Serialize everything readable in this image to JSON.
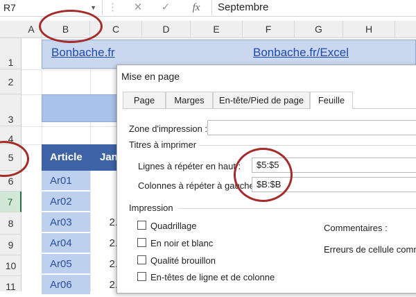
{
  "formula_bar": {
    "name_box": "R7",
    "cancel_icon": "✕",
    "enter_icon": "✓",
    "fx_label": "fx",
    "content": "Septembre"
  },
  "columns": [
    "A",
    "B",
    "C",
    "D",
    "E",
    "F",
    "G",
    "H"
  ],
  "rows": [
    "1",
    "2",
    "3",
    "4",
    "5",
    "6",
    "7",
    "8",
    "9",
    "10",
    "11"
  ],
  "sheet": {
    "banner_left": "Bonbache.fr",
    "banner_right": "Bonbache.fr/Excel",
    "table_header": "Article",
    "table_header_cut": "Janv",
    "articles": [
      "Ar01",
      "Ar02",
      "Ar03",
      "Ar04",
      "Ar05",
      "Ar06"
    ],
    "values_cut": [
      "",
      "",
      "2.",
      "2.",
      "2.",
      "2."
    ]
  },
  "dialog": {
    "title": "Mise en page",
    "tabs": [
      "Page",
      "Marges",
      "En-tête/Pied de page",
      "Feuille"
    ],
    "active_tab": "Feuille",
    "print_area_label": "Zone d'impression :",
    "print_area_value": "",
    "titles_group": "Titres à imprimer",
    "rows_repeat_label": "Lignes à répéter en haut :",
    "rows_repeat_value": "$5:$5",
    "cols_repeat_label": "Colonnes à répéter à gauche :",
    "cols_repeat_value": "$B:$B",
    "print_group": "Impression",
    "checkboxes": [
      "Quadrillage",
      "En noir et blanc",
      "Qualité brouillon",
      "En-têtes de ligne et de colonne"
    ],
    "comments_label": "Commentaires :",
    "errors_label": "Erreurs de cellule comme"
  },
  "annotation_color": "#a52a2a"
}
